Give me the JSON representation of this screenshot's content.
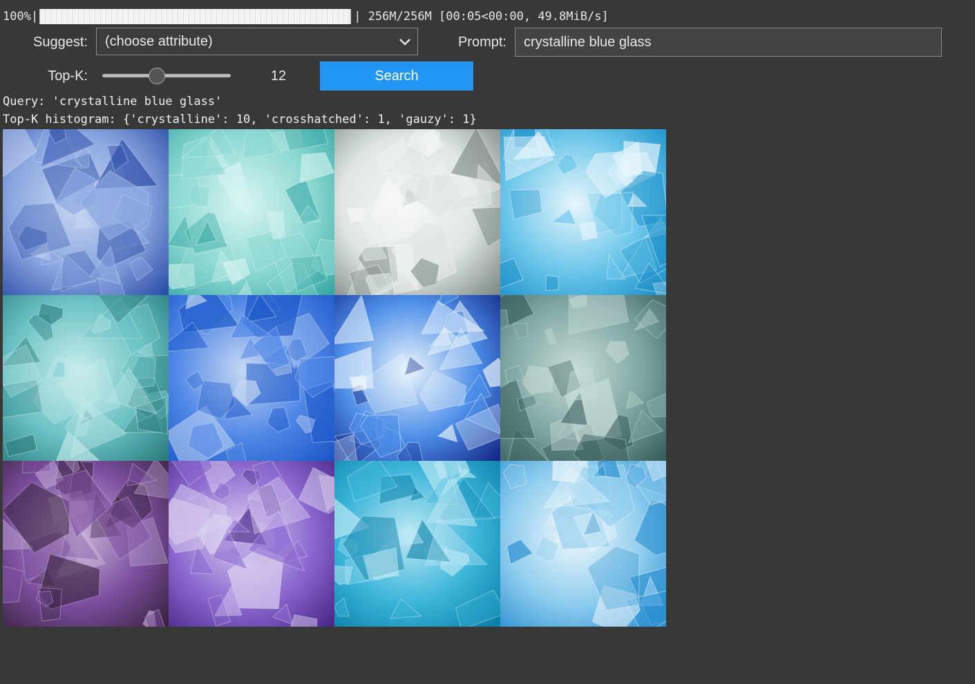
{
  "progress": {
    "percent_text": "100%",
    "fraction": 1.0,
    "stats_text": " 256M/256M [00:05<00:00, 49.8MiB/s]"
  },
  "controls": {
    "suggest_label": "Suggest:",
    "suggest_value": "(choose attribute)",
    "prompt_label": "Prompt:",
    "prompt_value": "crystalline blue glass",
    "topk_label": "Top-K:",
    "topk_value": "12",
    "topk_fraction": 0.42,
    "search_label": "Search",
    "accent_color": "#2196f3"
  },
  "output": {
    "query_line": "Query: 'crystalline blue glass'",
    "histogram_line": "Top-K histogram: {'crystalline': 10, 'crosshatched': 1, 'gauzy': 1}"
  },
  "results": [
    {
      "kind": "frosted-blue-glass",
      "colors": [
        "#2e4fa8",
        "#8aa6e0",
        "#c9d8f2"
      ]
    },
    {
      "kind": "aqua-crystal",
      "colors": [
        "#3aa9a6",
        "#8fd9d3",
        "#d9f5f2"
      ]
    },
    {
      "kind": "quartz-cluster",
      "colors": [
        "#7f8c8a",
        "#dfe6e2",
        "#f6f8f6"
      ]
    },
    {
      "kind": "blue-glass-pieces",
      "colors": [
        "#1a8fc8",
        "#6cc6ea",
        "#e9f6fb"
      ]
    },
    {
      "kind": "teal-druzy",
      "colors": [
        "#2c7d80",
        "#6cc2c4",
        "#c8ecec"
      ]
    },
    {
      "kind": "blue-gauze",
      "colors": [
        "#1f58c9",
        "#4f87e6",
        "#c7d8f2"
      ]
    },
    {
      "kind": "blue-geode",
      "colors": [
        "#152a8a",
        "#4d8ee8",
        "#eaf4fb"
      ]
    },
    {
      "kind": "green-crystal",
      "colors": [
        "#3a5f5c",
        "#7fa6a2",
        "#c7dcd8"
      ]
    },
    {
      "kind": "amethyst",
      "colors": [
        "#3a2340",
        "#7d4fa0",
        "#c9b6d8"
      ]
    },
    {
      "kind": "purple-druzy",
      "colors": [
        "#4b2a8a",
        "#8c6ad0",
        "#dcd2f0"
      ]
    },
    {
      "kind": "blue-faceted-bead",
      "colors": [
        "#0b7fa8",
        "#3bb4d9",
        "#bfe9f5"
      ]
    },
    {
      "kind": "blue-topaz",
      "colors": [
        "#2b8fd0",
        "#8fcdee",
        "#f1f8fc"
      ]
    }
  ]
}
